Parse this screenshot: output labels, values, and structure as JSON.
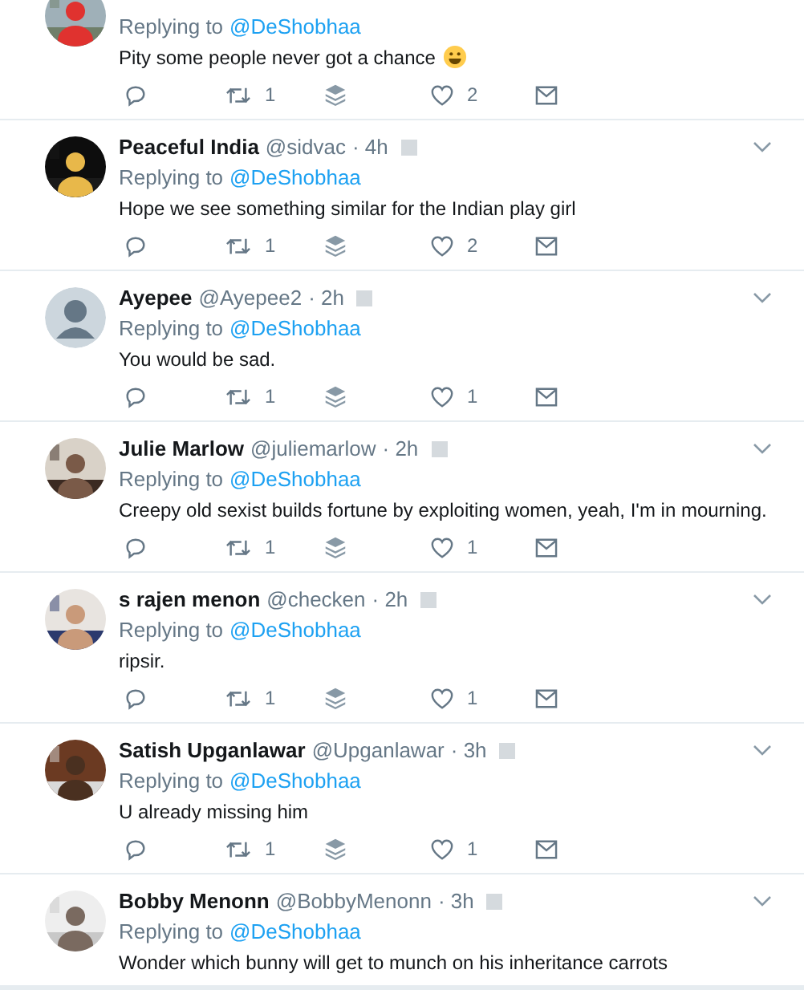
{
  "tweets": [
    {
      "replying_label": "Replying to",
      "replying_to": "@DeShobhaa",
      "text": "Pity some people never got a chance",
      "trailing_icon": {
        "kind": "smiley"
      },
      "actions": {
        "retweets": "1",
        "likes": "2"
      }
    },
    {
      "name": "Peaceful India",
      "handle": "@sidvac",
      "time": "· 4h",
      "replying_label": "Replying to",
      "replying_to": "@DeShobhaa",
      "text": "Hope we see something similar for the Indian play girl",
      "actions": {
        "retweets": "1",
        "likes": "2"
      }
    },
    {
      "avatar": {
        "kind": "default"
      },
      "name": "Ayepee",
      "handle": "@Ayepee2",
      "time": "· 2h",
      "replying_label": "Replying to",
      "replying_to": "@DeShobhaa",
      "text": "You would be sad.",
      "actions": {
        "retweets": "1",
        "likes": "1"
      }
    },
    {
      "name": "Julie Marlow",
      "handle": "@juliemarlow",
      "time": "· 2h",
      "replying_label": "Replying to",
      "replying_to": "@DeShobhaa",
      "text": "Creepy old sexist builds fortune by exploiting women, yeah, I'm in mourning.",
      "actions": {
        "retweets": "1",
        "likes": "1"
      }
    },
    {
      "name": "s rajen menon",
      "handle": "@checken",
      "time": "· 2h",
      "replying_label": "Replying to",
      "replying_to": "@DeShobhaa",
      "text": "ripsir.",
      "actions": {
        "retweets": "1",
        "likes": "1"
      }
    },
    {
      "name": "Satish Upganlawar",
      "handle": "@Upganlawar",
      "time": "· 3h",
      "replying_label": "Replying to",
      "replying_to": "@DeShobhaa",
      "text": "U already missing him",
      "actions": {
        "retweets": "1",
        "likes": "1"
      }
    },
    {
      "name": "Bobby Menonn",
      "handle": "@BobbyMenonn",
      "time": "· 3h",
      "replying_label": "Replying to",
      "replying_to": "@DeShobhaa",
      "text": "Wonder which bunny will get to munch on his inheritance carrots"
    }
  ]
}
